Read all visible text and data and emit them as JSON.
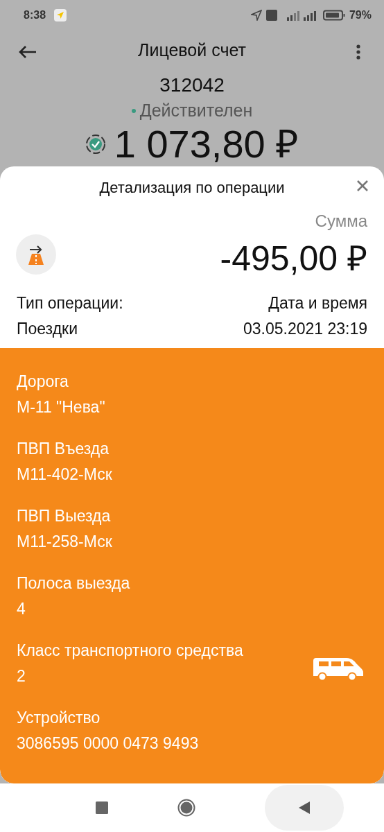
{
  "status_bar": {
    "time": "8:38",
    "battery": "79%"
  },
  "app_bar": {
    "title": "Лицевой счет"
  },
  "account": {
    "number": "312042",
    "status": "Действителен",
    "balance": "1 073,80 ₽"
  },
  "sheet": {
    "title": "Детализация по операции",
    "sum_label": "Сумма",
    "amount": "-495,00 ₽",
    "type_label": "Тип операции:",
    "type_value": "Поездки",
    "date_label": "Дата и время",
    "date_value": "03.05.2021 23:19"
  },
  "details": [
    {
      "kind": "text",
      "label": "Дорога",
      "value": "М-11 \"Нева\""
    },
    {
      "kind": "text",
      "label": "ПВП Въезда",
      "value": "М11-402-Мск"
    },
    {
      "kind": "text",
      "label": "ПВП Выезда",
      "value": "М11-258-Мск"
    },
    {
      "kind": "text",
      "label": "Полоса выезда",
      "value": "4"
    },
    {
      "kind": "vehicle",
      "label": "Класс транспортного средства",
      "value": "2"
    },
    {
      "kind": "text",
      "label": "Устройство",
      "value": "3086595 0000 0473 9493"
    }
  ]
}
